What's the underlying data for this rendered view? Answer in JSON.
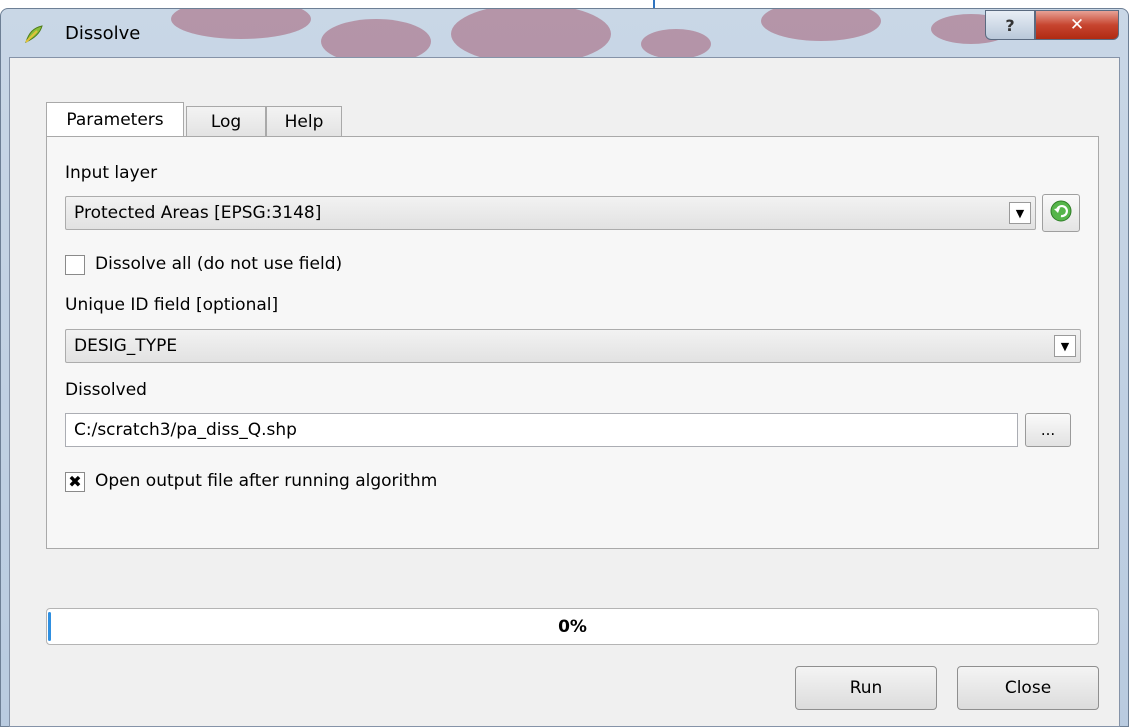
{
  "window": {
    "title": "Dissolve",
    "icons": {
      "app": "qgis-leaf-icon",
      "help": "question-icon",
      "close": "close-icon"
    },
    "help_label": "?",
    "close_label": "✕"
  },
  "tabs": [
    {
      "label": "Parameters",
      "active": true
    },
    {
      "label": "Log",
      "active": false
    },
    {
      "label": "Help",
      "active": false
    }
  ],
  "parameters": {
    "input_layer_label": "Input layer",
    "input_layer_value": "Protected Areas [EPSG:3148]",
    "dissolve_all_label": "Dissolve all (do not use field)",
    "dissolve_all_checked": false,
    "unique_id_label": "Unique ID field [optional]",
    "unique_id_value": "DESIG_TYPE",
    "dissolved_label": "Dissolved",
    "dissolved_path": "C:/scratch3/pa_diss_Q.shp",
    "browse_label": "...",
    "open_output_label": "Open output file after running algorithm",
    "open_output_checked": true,
    "open_output_mark": "✖"
  },
  "progress": {
    "value": 0,
    "label": "0%"
  },
  "buttons": {
    "run": "Run",
    "close": "Close"
  },
  "colors": {
    "progress_fill": "#2f8fe0",
    "close_button": "#c7452f",
    "refresh_icon": "#3fa33a"
  }
}
